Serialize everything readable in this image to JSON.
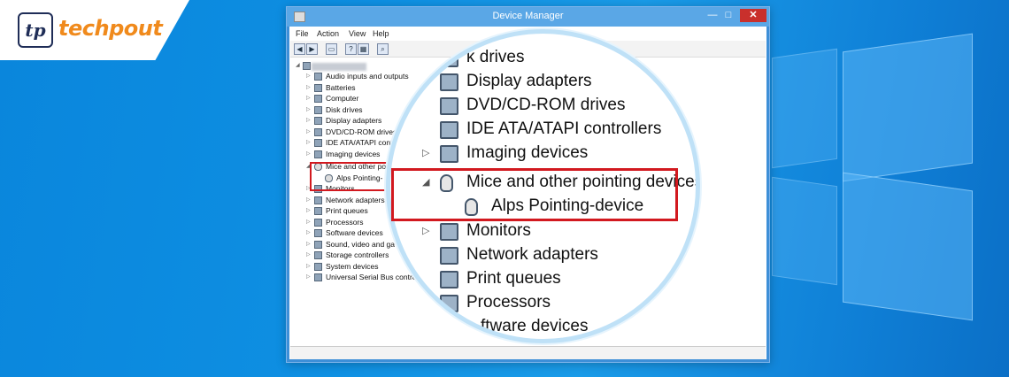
{
  "brand": {
    "badge_letters": "tp",
    "name": "techpout"
  },
  "window": {
    "title": "Device Manager",
    "controls": {
      "minimize": "—",
      "maximize": "□",
      "close": "✕"
    },
    "menu": [
      "File",
      "Action",
      "View",
      "Help"
    ],
    "toolbar_icons": [
      "back-icon",
      "forward-icon",
      "properties-icon",
      "help-icon",
      "show-hidden-icon",
      "scan-hardware-icon"
    ]
  },
  "tree": {
    "items": [
      {
        "label": "Audio inputs and outputs",
        "icon": "speaker-icon",
        "expanded": false
      },
      {
        "label": "Batteries",
        "icon": "battery-icon",
        "expanded": false
      },
      {
        "label": "Computer",
        "icon": "computer-icon",
        "expanded": false
      },
      {
        "label": "Disk drives",
        "icon": "disk-icon",
        "expanded": false
      },
      {
        "label": "Display adapters",
        "icon": "display-adapter-icon",
        "expanded": false
      },
      {
        "label": "DVD/CD-ROM drives",
        "icon": "dvd-icon",
        "expanded": false
      },
      {
        "label": "IDE ATA/ATAPI cont",
        "icon": "ide-icon",
        "expanded": false
      },
      {
        "label": "Imaging devices",
        "icon": "camera-icon",
        "expanded": false
      },
      {
        "label": "Mice and other po",
        "icon": "mouse-icon",
        "expanded": true
      },
      {
        "label": "Alps Pointing-",
        "icon": "mouse-icon",
        "child": true
      },
      {
        "label": "Monitors",
        "icon": "monitor-icon",
        "expanded": false
      },
      {
        "label": "Network adapters",
        "icon": "network-icon",
        "expanded": false
      },
      {
        "label": "Print queues",
        "icon": "printer-icon",
        "expanded": false
      },
      {
        "label": "Processors",
        "icon": "processor-icon",
        "expanded": false
      },
      {
        "label": "Software devices",
        "icon": "software-icon",
        "expanded": false
      },
      {
        "label": "Sound, video and ga",
        "icon": "sound-icon",
        "expanded": false
      },
      {
        "label": "Storage controllers",
        "icon": "storage-icon",
        "expanded": false
      },
      {
        "label": "System devices",
        "icon": "system-icon",
        "expanded": false
      },
      {
        "label": "Universal Serial Bus contro",
        "icon": "usb-icon",
        "expanded": false
      }
    ]
  },
  "magnified": {
    "items": [
      {
        "label": "k drives",
        "icon": "disk-icon"
      },
      {
        "label": "Display adapters",
        "icon": "display-adapter-icon"
      },
      {
        "label": "DVD/CD-ROM drives",
        "icon": "dvd-icon"
      },
      {
        "label": "IDE ATA/ATAPI controllers",
        "icon": "ide-icon"
      },
      {
        "label": "Imaging devices",
        "icon": "camera-icon"
      },
      {
        "label": "Mice and other pointing devices",
        "icon": "mouse-icon",
        "expanded": true
      },
      {
        "label": "Alps Pointing-device",
        "icon": "mouse-icon",
        "child": true
      },
      {
        "label": "Monitors",
        "icon": "monitor-icon"
      },
      {
        "label": "Network adapters",
        "icon": "network-icon"
      },
      {
        "label": "Print queues",
        "icon": "printer-icon"
      },
      {
        "label": "Processors",
        "icon": "processor-icon"
      },
      {
        "label": "ftware devices",
        "icon": "software-icon"
      }
    ]
  },
  "colors": {
    "highlight": "#d2191f",
    "desktop": "#0e8fe2",
    "titlebar": "#5aa7e6"
  }
}
